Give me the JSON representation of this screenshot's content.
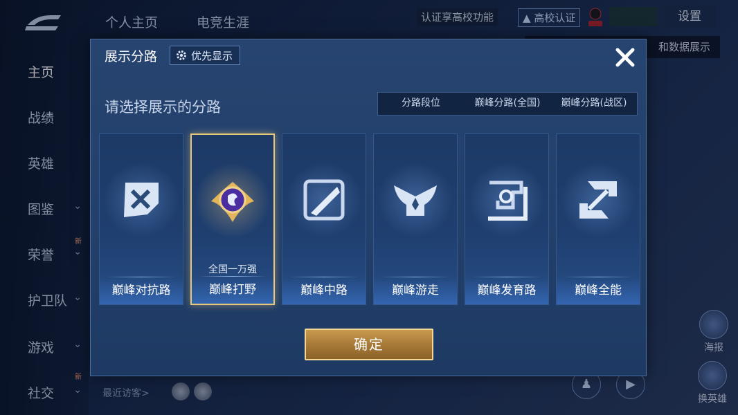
{
  "background": {
    "top_tabs": [
      "个人主页",
      "电竞生涯"
    ],
    "side_menu": [
      {
        "label": "主页",
        "active": true,
        "chevron": false
      },
      {
        "label": "战绩",
        "active": false,
        "chevron": false
      },
      {
        "label": "英雄",
        "active": false,
        "chevron": false
      },
      {
        "label": "图鉴",
        "active": false,
        "chevron": true
      },
      {
        "label": "荣誉",
        "active": false,
        "chevron": true
      },
      {
        "label": "护卫队",
        "active": false,
        "chevron": true
      },
      {
        "label": "游戏",
        "active": false,
        "chevron": true
      },
      {
        "label": "社交",
        "active": false,
        "chevron": true
      }
    ],
    "new_badge": "新",
    "campus_unlock": "认证享高校功能",
    "campus_cert": "高校认证",
    "settings": "设置",
    "tooltip_partial": "和数据展示",
    "recent_visitors": "最近访客>",
    "right_buttons": [
      "海报",
      "换英雄"
    ]
  },
  "modal": {
    "title": "展示分路",
    "priority_label": "优先显示",
    "subtitle": "请选择展示的分路",
    "segments": [
      {
        "label": "分路段位",
        "selected": false
      },
      {
        "label": "巅峰分路(全国)",
        "selected": true
      },
      {
        "label": "巅峰分路(战区)",
        "selected": false
      }
    ],
    "cards": [
      {
        "label": "巅峰对抗路",
        "selected": false,
        "rank": "",
        "icon": "clash-lane-icon"
      },
      {
        "label": "巅峰打野",
        "selected": true,
        "rank": "全国一万强",
        "icon": "jungle-medal-icon"
      },
      {
        "label": "巅峰中路",
        "selected": false,
        "rank": "",
        "icon": "mid-lane-icon"
      },
      {
        "label": "巅峰游走",
        "selected": false,
        "rank": "",
        "icon": "roam-wings-icon"
      },
      {
        "label": "巅峰发育路",
        "selected": false,
        "rank": "",
        "icon": "farm-lane-icon"
      },
      {
        "label": "巅峰全能",
        "selected": false,
        "rank": "",
        "icon": "all-round-icon"
      }
    ],
    "confirm_label": "确定"
  },
  "colors": {
    "accent_gold": "#e8c77a",
    "segment_selected": "#3b79c8",
    "modal_bg": "#22406b"
  }
}
